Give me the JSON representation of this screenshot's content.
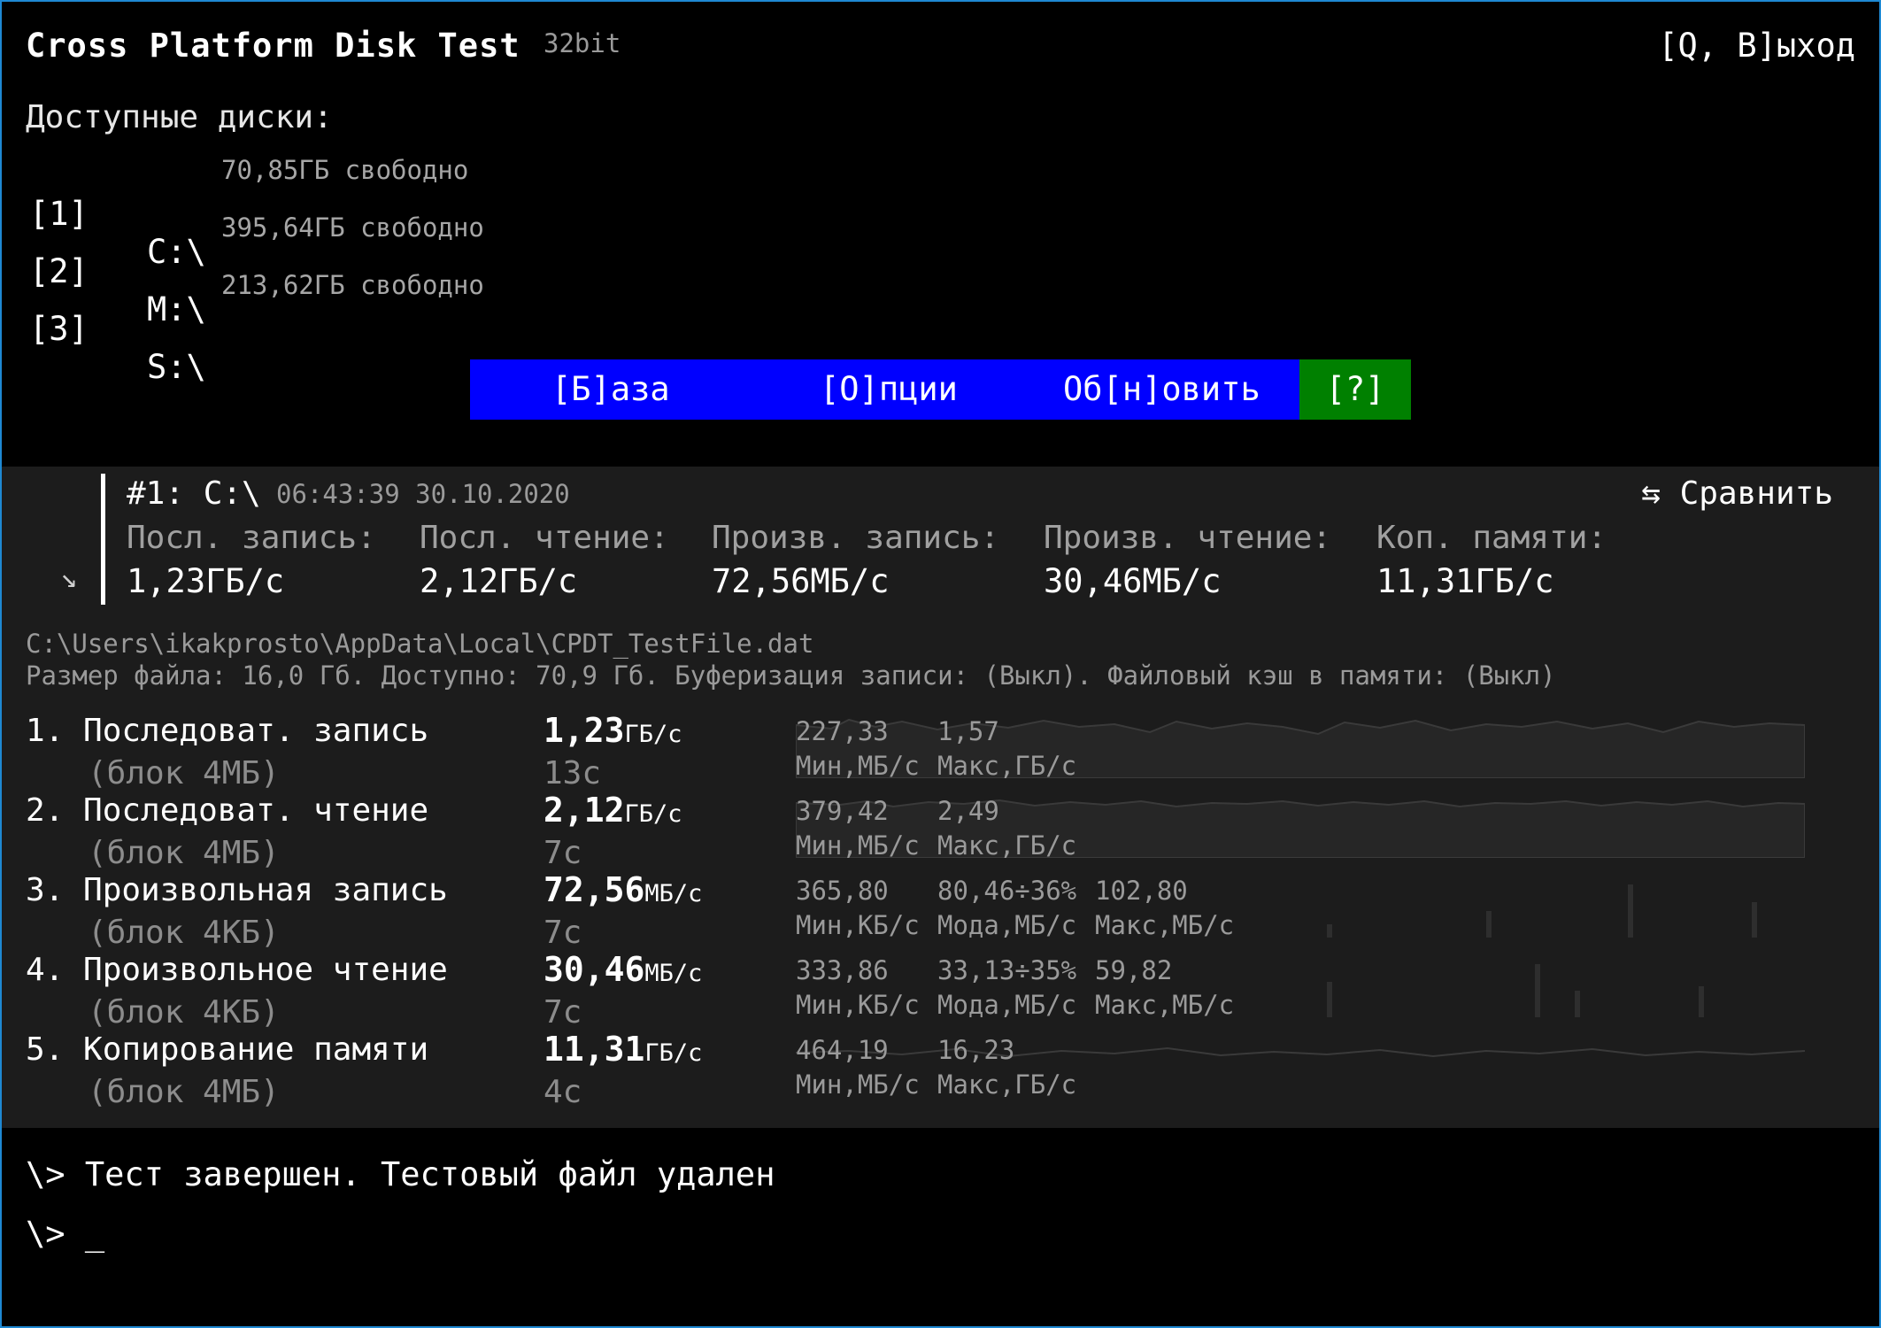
{
  "app": {
    "title": "Cross Platform Disk Test",
    "arch": "32bit",
    "quit_label": "[Q, В]ыход"
  },
  "drives": {
    "heading": "Доступные диски:",
    "items": [
      {
        "key": "[1]",
        "letter": "C:\\",
        "free": "70,85ГБ свободно"
      },
      {
        "key": "[2]",
        "letter": "M:\\",
        "free": "395,64ГБ свободно"
      },
      {
        "key": "[3]",
        "letter": "S:\\",
        "free": "213,62ГБ свободно"
      }
    ]
  },
  "menu": {
    "base": "[Б]аза",
    "options": "[О]пции",
    "refresh": "Об[н]овить",
    "help": "[?]"
  },
  "summary": {
    "run_id": "#1: C:\\",
    "timestamp": "06:43:39 30.10.2020",
    "compare": "⇆ Сравнить",
    "expand_icon": "↘",
    "columns": [
      {
        "label": "Посл. запись:",
        "value": "1,23ГБ/с"
      },
      {
        "label": "Посл. чтение:",
        "value": "2,12ГБ/с"
      },
      {
        "label": "Произв. запись:",
        "value": "72,56МБ/с"
      },
      {
        "label": "Произв. чтение:",
        "value": "30,46МБ/с"
      },
      {
        "label": "Коп. памяти:",
        "value": "11,31ГБ/с"
      }
    ]
  },
  "file": {
    "path": "C:\\Users\\ikakprosto\\AppData\\Local\\CPDT_TestFile.dat",
    "info": "Размер файла: 16,0 Гб. Доступно: 70,9 Гб. Буферизация записи: (Выкл). Файловый кэш в памяти: (Выкл)"
  },
  "tests": [
    {
      "name": "1. Последоват. запись",
      "block": "(блок 4МБ)",
      "value": "1,23",
      "unit": "ГБ/с",
      "time": "13с",
      "stats": [
        {
          "value": "227,33",
          "label": "Мин,МБ/с"
        },
        {
          "value": "1,57",
          "label": "Макс,ГБ/с"
        }
      ]
    },
    {
      "name": "2. Последоват. чтение",
      "block": "(блок 4МБ)",
      "value": "2,12",
      "unit": "ГБ/с",
      "time": "7с",
      "stats": [
        {
          "value": "379,42",
          "label": "Мин,МБ/с"
        },
        {
          "value": "2,49",
          "label": "Макс,ГБ/с"
        }
      ]
    },
    {
      "name": "3. Произвольная запись",
      "block": "(блок 4КБ)",
      "value": "72,56",
      "unit": "МБ/с",
      "time": "7с",
      "stats": [
        {
          "value": "365,80",
          "label": "Мин,КБ/с"
        },
        {
          "value": "80,46÷36%",
          "label": "Мода,МБ/с"
        },
        {
          "value": "102,80",
          "label": "Макс,МБ/с"
        }
      ]
    },
    {
      "name": "4. Произвольное чтение",
      "block": "(блок 4КБ)",
      "value": "30,46",
      "unit": "МБ/с",
      "time": "7с",
      "stats": [
        {
          "value": "333,86",
          "label": "Мин,КБ/с"
        },
        {
          "value": "33,13÷35%",
          "label": "Мода,МБ/с"
        },
        {
          "value": "59,82",
          "label": "Макс,МБ/с"
        }
      ]
    },
    {
      "name": "5. Копирование памяти",
      "block": "(блок 4МБ)",
      "value": "11,31",
      "unit": "ГБ/с",
      "time": "4с",
      "stats": [
        {
          "value": "464,19",
          "label": "Мин,МБ/с"
        },
        {
          "value": "16,23",
          "label": "Макс,ГБ/с"
        }
      ]
    }
  ],
  "console": {
    "line1": "\\> Тест завершен. Тестовый файл удален",
    "line2": "\\> _"
  },
  "colors": {
    "frame": "#1e88d2",
    "menu_bg": "#0000ff",
    "help_bg": "#008000",
    "results_bg": "#1c1c1c",
    "sparkline": "#3a3a3a"
  }
}
